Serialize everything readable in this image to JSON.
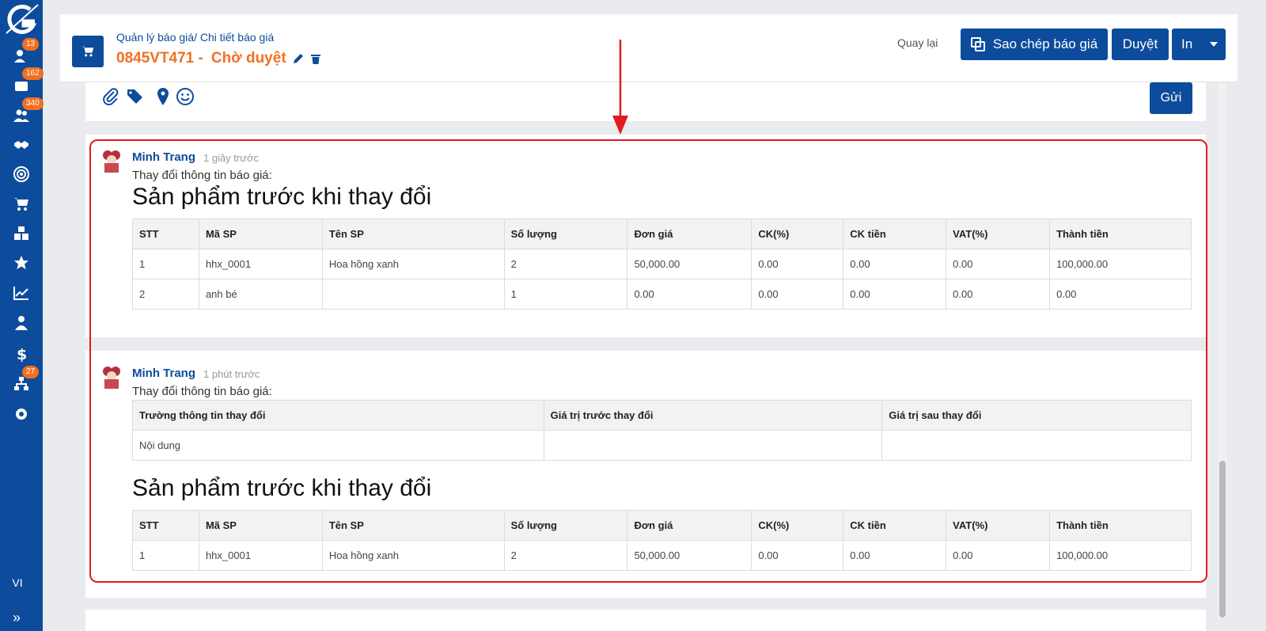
{
  "sidebar": {
    "badges": {
      "contacts": "13",
      "messages": "162",
      "customers": "340",
      "org": "27"
    },
    "lang": "VI"
  },
  "header": {
    "breadcrumb": "Quản lý báo giá/ Chi tiết báo giá",
    "quote_code": "0845VT471 -",
    "status": "Chờ duyệt",
    "back_label": "Quay lại",
    "copy_label": "Sao chép báo giá",
    "approve_label": "Duyệt",
    "print_label": "In"
  },
  "composer": {
    "send_label": "Gửi"
  },
  "activity": [
    {
      "author": "Minh Trang",
      "time": "1 giây trước",
      "change_label": "Thay đổi thông tin báo giá:",
      "section_title": "Sản phẩm trước khi thay đổi",
      "product_headers": [
        "STT",
        "Mã SP",
        "Tên SP",
        "Số lượng",
        "Đơn giá",
        "CK(%)",
        "CK tiền",
        "VAT(%)",
        "Thành tiền"
      ],
      "products": [
        [
          "1",
          "hhx_0001",
          "Hoa hồng xanh",
          "2",
          "50,000.00",
          "0.00",
          "0.00",
          "0.00",
          "100,000.00"
        ],
        [
          "2",
          "anh bé",
          "",
          "1",
          "0.00",
          "0.00",
          "0.00",
          "0.00",
          "0.00"
        ]
      ]
    },
    {
      "author": "Minh Trang",
      "time": "1 phút trước",
      "change_label": "Thay đổi thông tin báo giá:",
      "field_headers": [
        "Trường thông tin thay đổi",
        "Giá trị trước thay đổi",
        "Giá trị sau thay đổi"
      ],
      "fields": [
        [
          "Nội dung",
          "",
          ""
        ]
      ],
      "section_title": "Sản phẩm trước khi thay đổi",
      "product_headers": [
        "STT",
        "Mã SP",
        "Tên SP",
        "Số lượng",
        "Đơn giá",
        "CK(%)",
        "CK tiền",
        "VAT(%)",
        "Thành tiền"
      ],
      "products": [
        [
          "1",
          "hhx_0001",
          "Hoa hồng xanh",
          "2",
          "50,000.00",
          "0.00",
          "0.00",
          "0.00",
          "100,000.00"
        ]
      ]
    }
  ],
  "colors": {
    "primary": "#0d4c9c",
    "accent": "#f36f21",
    "highlight": "#e21b23"
  }
}
